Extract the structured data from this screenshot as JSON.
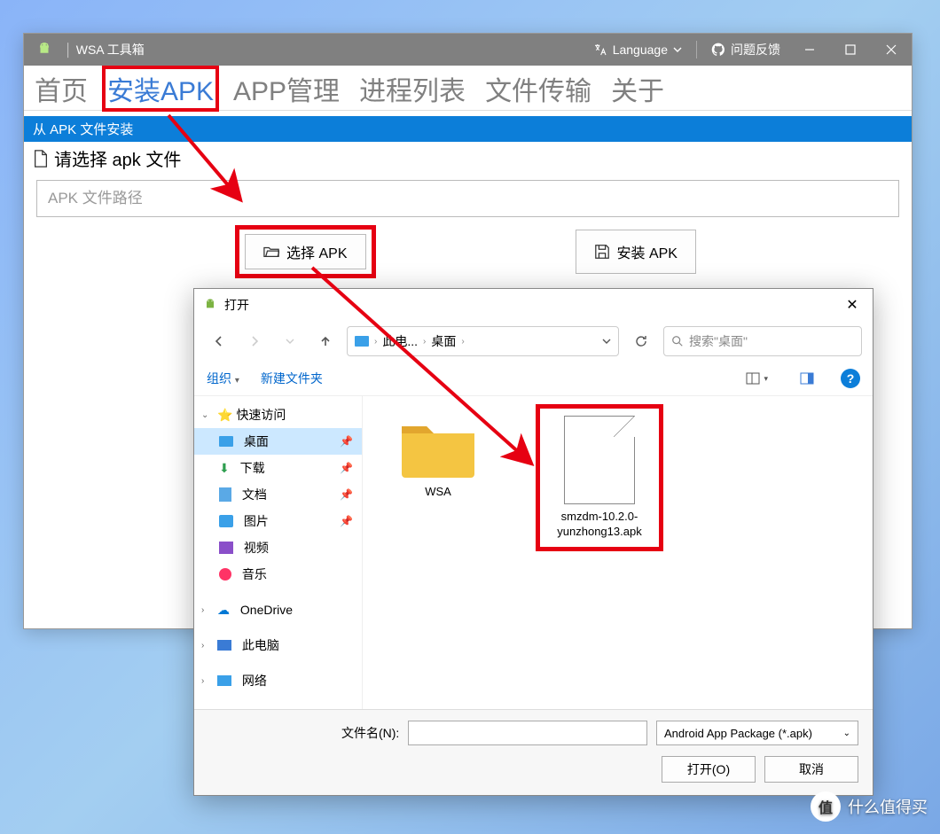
{
  "wsa": {
    "title": "WSA 工具箱",
    "lang_label": "Language",
    "feedback": "问题反馈",
    "tabs": [
      "首页",
      "安装APK",
      "APP管理",
      "进程列表",
      "文件传输",
      "关于"
    ],
    "section_header": "从 APK 文件安装",
    "select_label": "请选择 apk 文件",
    "path_placeholder": "APK 文件路径",
    "btn_select": "选择 APK",
    "btn_install": "安装 APK"
  },
  "filedlg": {
    "title": "打开",
    "crumb_pc": "此电...",
    "crumb_desktop": "桌面",
    "search_placeholder": "搜索\"桌面\"",
    "tb_organize": "组织",
    "tb_newfolder": "新建文件夹",
    "tree": {
      "quick": "快速访问",
      "desktop": "桌面",
      "downloads": "下载",
      "documents": "文档",
      "pictures": "图片",
      "videos": "视频",
      "music": "音乐",
      "onedrive": "OneDrive",
      "thispc": "此电脑",
      "network": "网络"
    },
    "files": {
      "folder1": "WSA",
      "file1": "smzdm-10.2.0-yunzhong13.apk"
    },
    "filename_label": "文件名(N):",
    "filetype": "Android App Package (*.apk)",
    "btn_open": "打开(O)",
    "btn_cancel": "取消"
  },
  "watermark": "什么值得买"
}
